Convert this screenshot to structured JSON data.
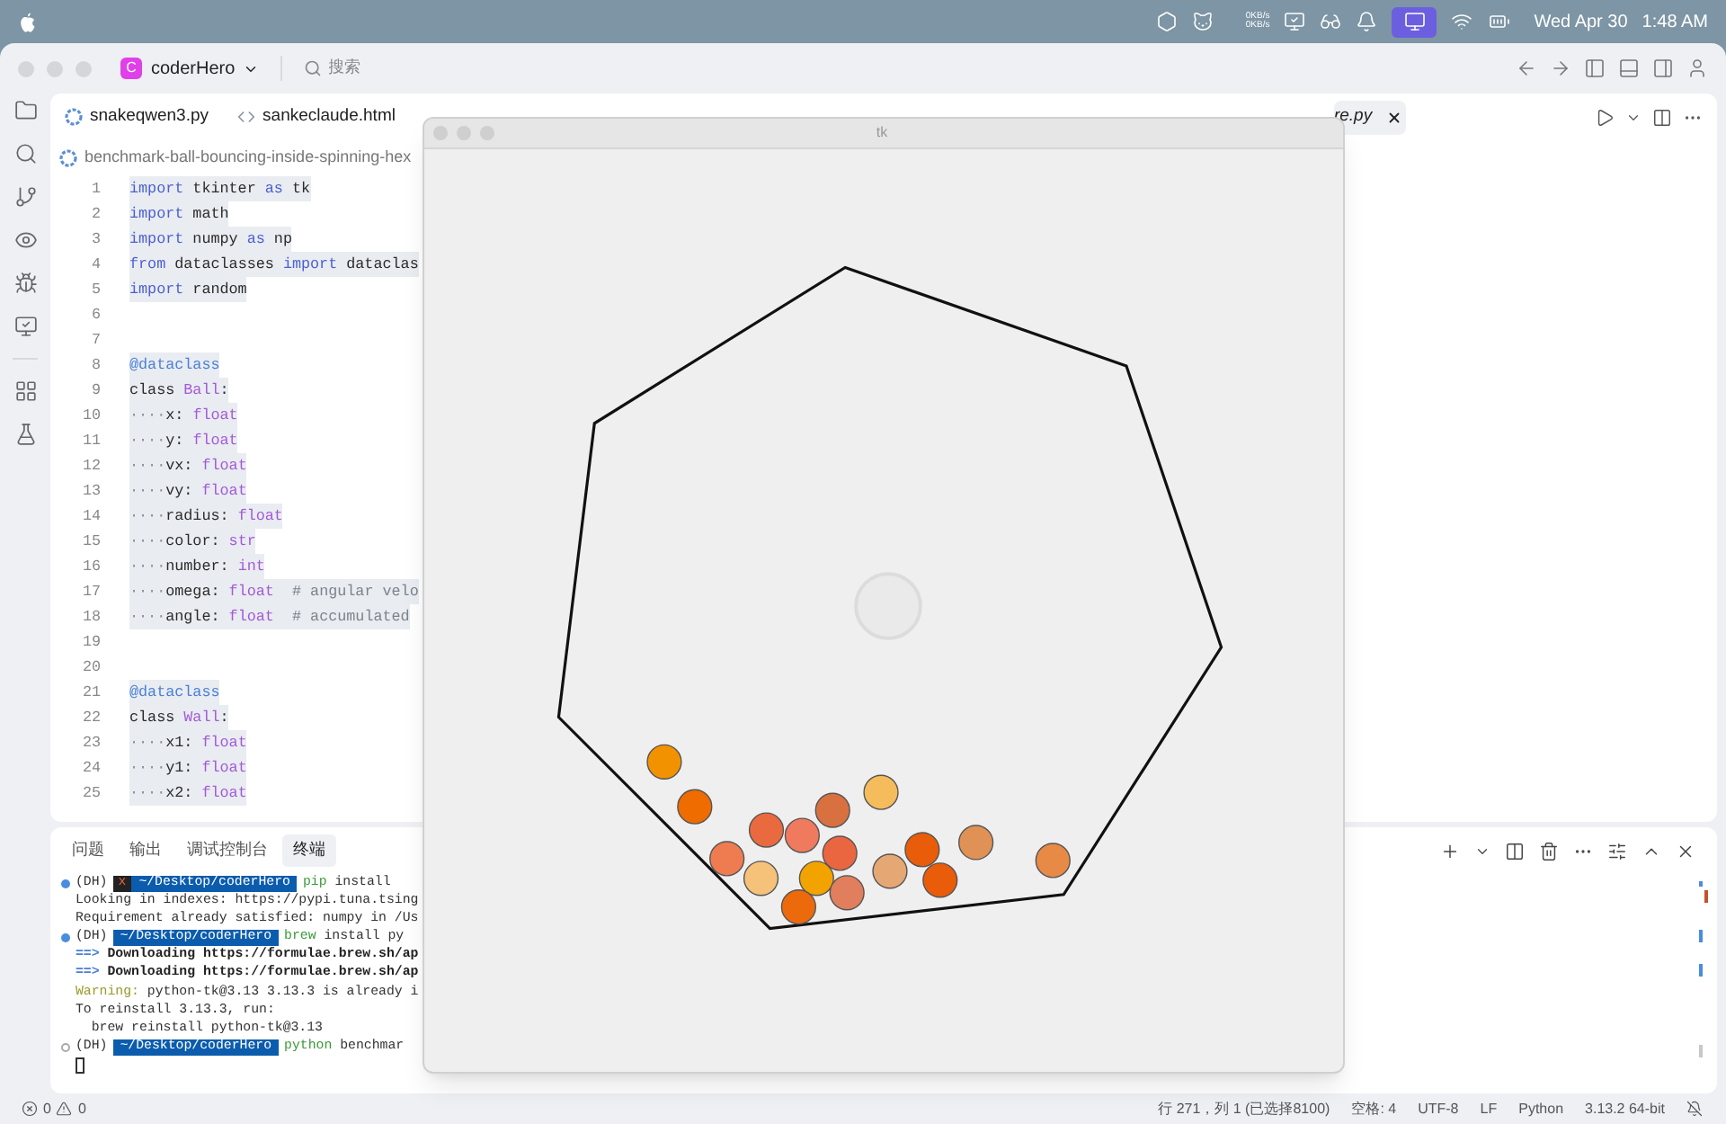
{
  "menubar": {
    "net_speed": [
      "0KB/s",
      "0KB/s"
    ],
    "date": "Wed Apr 30",
    "time": "1:48 AM"
  },
  "titlebar": {
    "project_initial": "C",
    "project": "coderHero",
    "search_placeholder": "搜索"
  },
  "editor_tabs": [
    {
      "label": "snakeqwen3.py",
      "kind": "python",
      "selected": false
    },
    {
      "label": "sankeclaude.html",
      "kind": "html",
      "selected": false
    },
    {
      "label": "re.py",
      "selected": true
    }
  ],
  "breadcrumb": "benchmark-ball-bouncing-inside-spinning-hex",
  "selection": true,
  "code": [
    {
      "n": "1",
      "tokens": [
        {
          "kind": "keyword",
          "text": "import"
        },
        {
          "kind": "plain",
          "text": " tkinter "
        },
        {
          "kind": "keyword",
          "text": "as"
        },
        {
          "kind": "plain",
          "text": " tk"
        }
      ]
    },
    {
      "n": "2",
      "tokens": [
        {
          "kind": "keyword",
          "text": "import"
        },
        {
          "kind": "plain",
          "text": " math"
        }
      ]
    },
    {
      "n": "3",
      "tokens": [
        {
          "kind": "keyword",
          "text": "import"
        },
        {
          "kind": "plain",
          "text": " numpy "
        },
        {
          "kind": "keyword",
          "text": "as"
        },
        {
          "kind": "plain",
          "text": " np"
        }
      ]
    },
    {
      "n": "4",
      "tokens": [
        {
          "kind": "keyword",
          "text": "from"
        },
        {
          "kind": "plain",
          "text": " dataclasses "
        },
        {
          "kind": "keyword",
          "text": "import"
        },
        {
          "kind": "plain",
          "text": " dataclas"
        }
      ]
    },
    {
      "n": "5",
      "tokens": [
        {
          "kind": "keyword",
          "text": "import"
        },
        {
          "kind": "plain",
          "text": " random"
        }
      ]
    },
    {
      "n": "6"
    },
    {
      "n": "7"
    },
    {
      "n": "8",
      "tokens": [
        {
          "kind": "decorator",
          "text": "@dataclass"
        }
      ]
    },
    {
      "n": "9",
      "tokens": [
        {
          "kind": "plain",
          "text": "class "
        },
        {
          "kind": "type",
          "text": "Ball"
        },
        {
          "kind": "plain",
          "text": ":"
        }
      ]
    },
    {
      "n": "10",
      "tokens": [
        {
          "kind": "whitespace",
          "text": "····"
        },
        {
          "kind": "plain",
          "text": "x: "
        },
        {
          "kind": "type",
          "text": "float"
        }
      ]
    },
    {
      "n": "11",
      "tokens": [
        {
          "kind": "whitespace",
          "text": "····"
        },
        {
          "kind": "plain",
          "text": "y: "
        },
        {
          "kind": "type",
          "text": "float"
        }
      ]
    },
    {
      "n": "12",
      "tokens": [
        {
          "kind": "whitespace",
          "text": "····"
        },
        {
          "kind": "plain",
          "text": "vx: "
        },
        {
          "kind": "type",
          "text": "float"
        }
      ]
    },
    {
      "n": "13",
      "tokens": [
        {
          "kind": "whitespace",
          "text": "····"
        },
        {
          "kind": "plain",
          "text": "vy: "
        },
        {
          "kind": "type",
          "text": "float"
        }
      ]
    },
    {
      "n": "14",
      "tokens": [
        {
          "kind": "whitespace",
          "text": "····"
        },
        {
          "kind": "plain",
          "text": "radius: "
        },
        {
          "kind": "type",
          "text": "float"
        }
      ]
    },
    {
      "n": "15",
      "tokens": [
        {
          "kind": "whitespace",
          "text": "····"
        },
        {
          "kind": "plain",
          "text": "color: "
        },
        {
          "kind": "type",
          "text": "str"
        }
      ]
    },
    {
      "n": "16",
      "tokens": [
        {
          "kind": "whitespace",
          "text": "····"
        },
        {
          "kind": "plain",
          "text": "number: "
        },
        {
          "kind": "type",
          "text": "int"
        }
      ]
    },
    {
      "n": "17",
      "tokens": [
        {
          "kind": "whitespace",
          "text": "····"
        },
        {
          "kind": "plain",
          "text": "omega: "
        },
        {
          "kind": "type",
          "text": "float"
        },
        {
          "kind": "comment",
          "text": "  # angular velo"
        }
      ]
    },
    {
      "n": "18",
      "tokens": [
        {
          "kind": "whitespace",
          "text": "····"
        },
        {
          "kind": "plain",
          "text": "angle: "
        },
        {
          "kind": "type",
          "text": "float"
        },
        {
          "kind": "comment",
          "text": "  # accumulated"
        }
      ]
    },
    {
      "n": "19"
    },
    {
      "n": "20"
    },
    {
      "n": "21",
      "tokens": [
        {
          "kind": "decorator",
          "text": "@dataclass"
        }
      ]
    },
    {
      "n": "22",
      "tokens": [
        {
          "kind": "plain",
          "text": "class "
        },
        {
          "kind": "type",
          "text": "Wall"
        },
        {
          "kind": "plain",
          "text": ":"
        }
      ]
    },
    {
      "n": "23",
      "tokens": [
        {
          "kind": "whitespace",
          "text": "····"
        },
        {
          "kind": "plain",
          "text": "x1: "
        },
        {
          "kind": "type",
          "text": "float"
        }
      ]
    },
    {
      "n": "24",
      "tokens": [
        {
          "kind": "whitespace",
          "text": "····"
        },
        {
          "kind": "plain",
          "text": "y1: "
        },
        {
          "kind": "type",
          "text": "float"
        }
      ]
    },
    {
      "n": "25",
      "tokens": [
        {
          "kind": "whitespace",
          "text": "····"
        },
        {
          "kind": "plain",
          "text": "x2: "
        },
        {
          "kind": "type",
          "text": "float"
        }
      ]
    }
  ],
  "panel_tabs": [
    {
      "label": "问题",
      "selected": false
    },
    {
      "label": "输出",
      "selected": false
    },
    {
      "label": "调试控制台",
      "selected": false
    },
    {
      "label": "终端",
      "selected": true
    }
  ],
  "terminal": [
    {
      "kind": "prompt",
      "finished": true,
      "env": "(DH)",
      "error_mark": "x",
      "path": "~/Desktop/coderHero",
      "cmd": "pip",
      "args": " install"
    },
    {
      "kind": "out",
      "text": "Looking in indexes: https://pypi.tuna.tsing"
    },
    {
      "kind": "out",
      "text": "Requirement already satisfied: numpy in /Us"
    },
    {
      "kind": "prompt",
      "finished": true,
      "env": "(DH)",
      "path": "~/Desktop/coderHero",
      "cmd": "brew",
      "args": " install py"
    },
    {
      "kind": "arrow",
      "prefix": "==>",
      "text": " Downloading https://formulae.brew.sh/ap"
    },
    {
      "kind": "arrow",
      "prefix": "==>",
      "text": " Downloading https://formulae.brew.sh/ap"
    },
    {
      "kind": "warning",
      "prefix": "Warning:",
      "text": " python-tk@3.13 3.13.3 is already i"
    },
    {
      "kind": "out",
      "text": "To reinstall 3.13.3, run:"
    },
    {
      "kind": "out",
      "text": "  brew reinstall python-tk@3.13"
    },
    {
      "kind": "prompt",
      "finished": false,
      "env": "(DH)",
      "path": "~/Desktop/coderHero",
      "cmd": "python",
      "args": " benchmar"
    },
    {
      "kind": "cursor"
    }
  ],
  "tk_window": {
    "title": "tk"
  },
  "status": {
    "errors": "0",
    "warnings": "0",
    "cursor": "行 271，列 1 (已选择8100)",
    "indent": "空格: 4",
    "encoding": "UTF-8",
    "eol": "LF",
    "language": "Python",
    "interpreter": "3.13.2 64-bit"
  }
}
